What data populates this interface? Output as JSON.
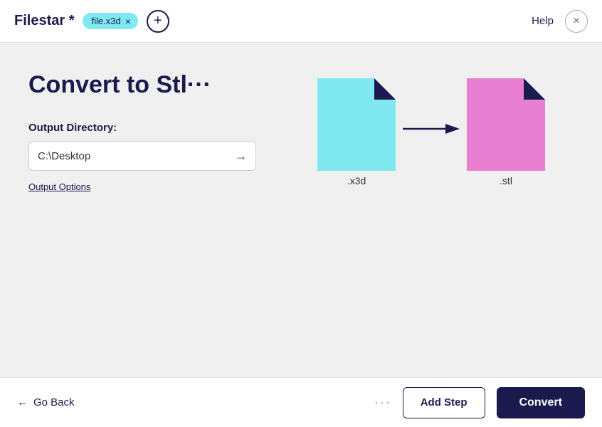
{
  "app": {
    "title": "Filestar *"
  },
  "header": {
    "file_tag": "file.x3d",
    "add_label": "+",
    "close_label": "×",
    "help_label": "Help"
  },
  "main": {
    "page_title": "Convert to Stl···",
    "output_label": "Output Directory:",
    "output_dir_value": "C:\\Desktop",
    "output_options_label": "Output Options",
    "file_from_label": ".x3d",
    "file_to_label": ".stl"
  },
  "footer": {
    "go_back_label": "Go Back",
    "more_options_label": "···",
    "add_step_label": "Add Step",
    "convert_label": "Convert"
  }
}
